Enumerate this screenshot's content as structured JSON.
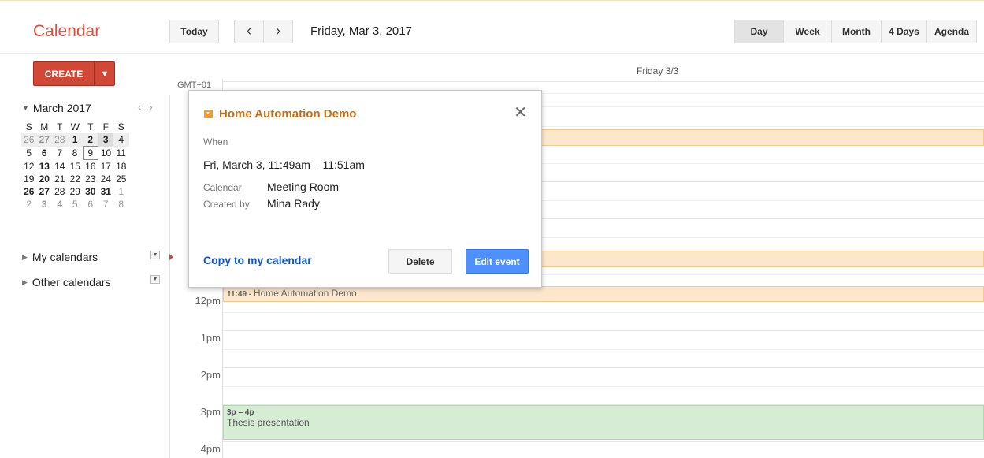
{
  "header": {
    "app_title": "Calendar",
    "today_label": "Today",
    "prev_icon": "‹",
    "next_icon": "›",
    "date_label": "Friday, Mar 3, 2017",
    "views": [
      "Day",
      "Week",
      "Month",
      "4 Days",
      "Agenda"
    ],
    "active_view": "Day"
  },
  "sidebar": {
    "create_label": "CREATE",
    "create_dropdown_icon": "▼",
    "mini_calendar": {
      "month_label": "March 2017",
      "weekday_headers": [
        "S",
        "M",
        "T",
        "W",
        "T",
        "F",
        "S"
      ],
      "weeks": [
        [
          "26",
          "27",
          "28",
          "1",
          "2",
          "3",
          "4"
        ],
        [
          "5",
          "6",
          "7",
          "8",
          "9",
          "10",
          "11"
        ],
        [
          "12",
          "13",
          "14",
          "15",
          "16",
          "17",
          "18"
        ],
        [
          "19",
          "20",
          "21",
          "22",
          "23",
          "24",
          "25"
        ],
        [
          "26",
          "27",
          "28",
          "29",
          "30",
          "31",
          "1"
        ],
        [
          "2",
          "3",
          "4",
          "5",
          "6",
          "7",
          "8"
        ]
      ]
    },
    "my_calendars_label": "My calendars",
    "other_calendars_label": "Other calendars"
  },
  "day_view": {
    "column_header": "Friday 3/3",
    "timezone_label": "GMT+01",
    "hour_labels": [
      "12pm",
      "1pm",
      "2pm",
      "3pm",
      "4pm"
    ],
    "events": [
      {
        "time": "11:49",
        "title": "Home Automation Demo",
        "color": "#fde7cc"
      },
      {
        "time": "3p – 4p",
        "title": "Thesis presentation",
        "color": "#d6ecd4"
      }
    ]
  },
  "popup": {
    "title": "Home Automation Demo",
    "when_label": "When",
    "when_value": "Fri, March 3, 11:49am – 11:51am",
    "calendar_label": "Calendar",
    "calendar_value": "Meeting Room",
    "created_by_label": "Created by",
    "created_by_value": "Mina Rady",
    "copy_label": "Copy to my calendar",
    "delete_label": "Delete",
    "edit_label": "Edit event",
    "close_icon": "✕"
  },
  "colors": {
    "brand_red": "#dd4b39",
    "create_button": "#d14836",
    "event_orange": "#fde7cc",
    "event_green": "#d6ecd4",
    "edit_button_blue": "#4d90fe",
    "link_blue": "#1155cc",
    "popup_title": "#c86d12"
  }
}
